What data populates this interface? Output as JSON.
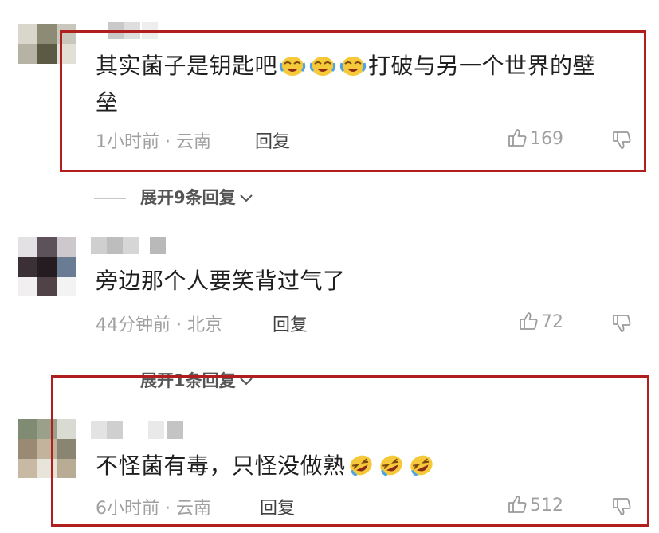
{
  "comments": [
    {
      "text_main": "其实菌子是钥匙吧",
      "text_after": "打破与另一个世界的壁",
      "text_line2": "垒",
      "time": "1小时前",
      "location": "云南",
      "reply_label": "回复",
      "likes": "169",
      "emoji": "crying-laughing-emoji",
      "highlighted": true
    },
    {
      "text_main": "旁边那个人要笑背过气了",
      "time": "44分钟前",
      "location": "北京",
      "reply_label": "回复",
      "likes": "72",
      "highlighted": false
    },
    {
      "text_main": "不怪菌有毒，只怪没做熟",
      "time": "6小时前",
      "location": "云南",
      "reply_label": "回复",
      "likes": "512",
      "emoji": "rolling-laughing-emoji",
      "highlighted": true
    }
  ],
  "expand_replies": [
    {
      "label": "展开9条回复"
    },
    {
      "label": "展开1条回复"
    }
  ],
  "colors": {
    "highlight_border": "#b01e1e",
    "meta_gray": "#a0a0a0",
    "text": "#1f1f1f"
  }
}
